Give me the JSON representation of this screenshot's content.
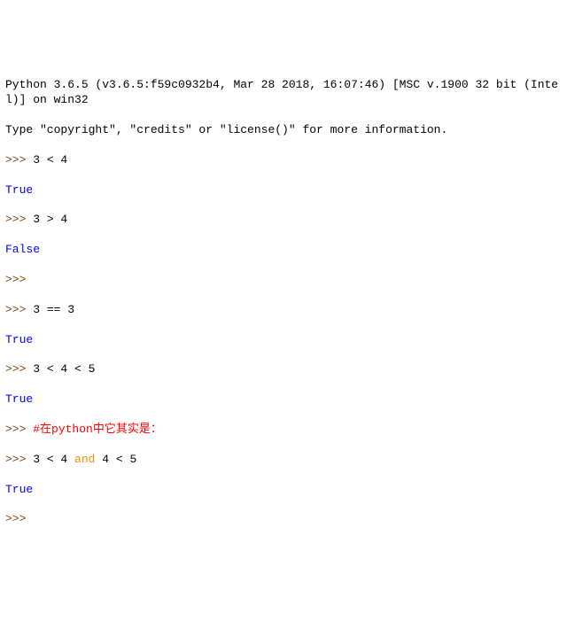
{
  "header": {
    "line1": "Python 3.6.5 (v3.6.5:f59c0932b4, Mar 28 2018, 16:07:46) [MSC v.1900 32 bit (Intel)] on win32",
    "line2": "Type \"copyright\", \"credits\" or \"license()\" for more information."
  },
  "prompt": ">>> ",
  "lines": [
    {
      "input": "3 < 4",
      "output": "True"
    },
    {
      "input": "3 > 4",
      "output": "False"
    },
    {
      "input": "",
      "output": null
    },
    {
      "input": "3 == 3",
      "output": "True"
    },
    {
      "input": "3 < 4 < 5",
      "output": "True"
    },
    {
      "comment": "#在python中它其实是："
    },
    {
      "rich_input": {
        "pre": "3 < 4 ",
        "kw": "and",
        "post": " 4 < 5"
      },
      "output": "True"
    }
  ],
  "final_prompt": ">>> "
}
